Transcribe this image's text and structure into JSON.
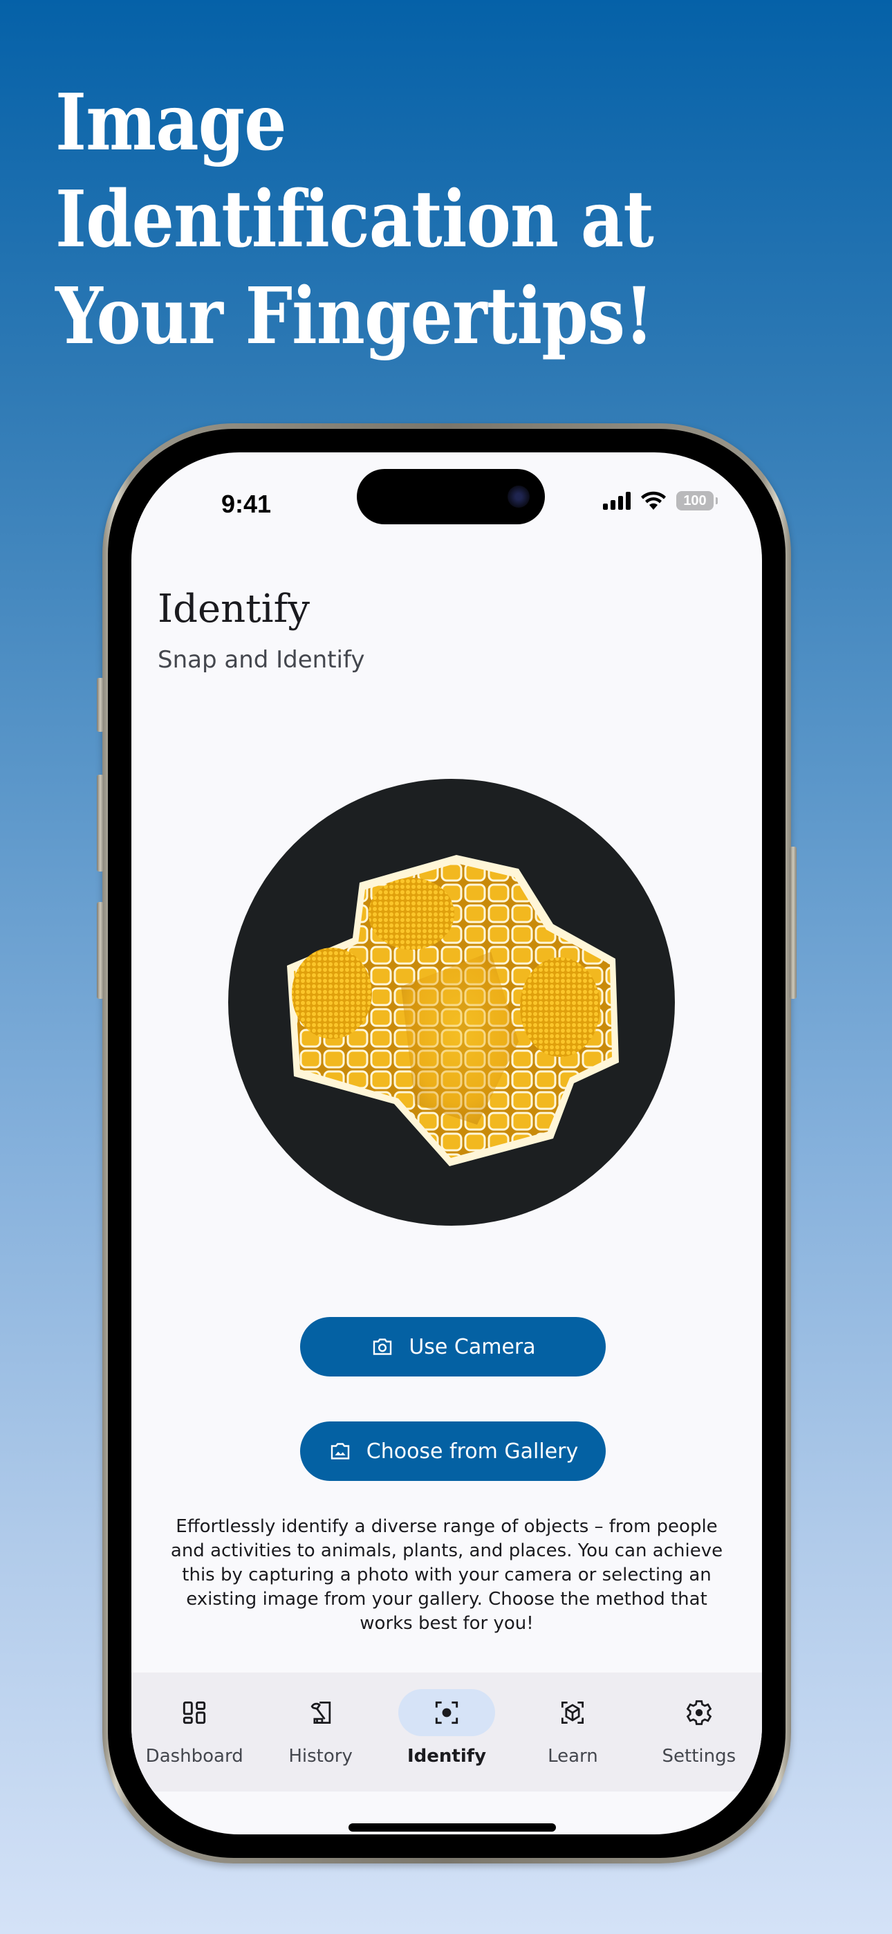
{
  "promo": {
    "headline_lines": [
      "Image",
      "Identification at",
      "Your Fingertips!"
    ]
  },
  "status_bar": {
    "time": "9:41",
    "battery": "100",
    "icons": [
      "signal-icon",
      "wifi-icon",
      "battery-icon"
    ]
  },
  "page": {
    "title": "Identify",
    "subtitle": "Snap and Identify"
  },
  "hero_image": {
    "alt": "Yellow honeycomb-like cellular structure on dark circular background"
  },
  "actions": {
    "camera_label": "Use Camera",
    "camera_icon": "camera-icon",
    "gallery_label": "Choose from Gallery",
    "gallery_icon": "gallery-icon"
  },
  "description": "Effortlessly identify a diverse range of objects – from people and activities to animals, plants, and places. You can achieve this by capturing a photo with your camera or selecting an existing image from your gallery. Choose the method that works best for you!",
  "nav": {
    "active": "Identify",
    "items": [
      {
        "label": "Dashboard",
        "icon": "dashboard-icon"
      },
      {
        "label": "History",
        "icon": "history-icon"
      },
      {
        "label": "Identify",
        "icon": "identify-focus-icon"
      },
      {
        "label": "Learn",
        "icon": "cube-scan-icon"
      },
      {
        "label": "Settings",
        "icon": "gear-icon"
      }
    ]
  },
  "colors": {
    "primary": "#0461a3",
    "nav_active_pill": "#d6e3f7",
    "screen_bg": "#f9f9fc",
    "nav_bg": "#eeedf2"
  }
}
